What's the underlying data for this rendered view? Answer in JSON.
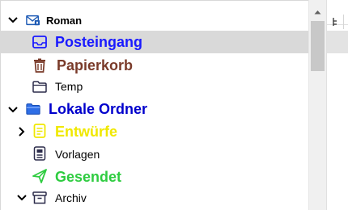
{
  "colors": {
    "selection": "#d9d9d9",
    "inbox_blue": "#1a1aff",
    "trash_brown": "#7a3b2a",
    "local_folders_blue": "#0000cc",
    "drafts_yellow": "#f0e800",
    "sent_green": "#2ecc40"
  },
  "tree": {
    "account": {
      "label": "Roman",
      "icon": "mail-account-icon"
    },
    "inbox": {
      "label": "Posteingang",
      "icon": "inbox-icon"
    },
    "trash": {
      "label": "Papierkorb",
      "icon": "trash-icon"
    },
    "temp": {
      "label": "Temp",
      "icon": "folder-icon"
    },
    "local_folders": {
      "label": "Lokale Ordner",
      "icon": "folder-icon"
    },
    "drafts": {
      "label": "Entwürfe",
      "icon": "drafts-icon"
    },
    "templates": {
      "label": "Vorlagen",
      "icon": "templates-icon"
    },
    "sent": {
      "label": "Gesendet",
      "icon": "send-icon"
    },
    "archive": {
      "label": "Archiv",
      "icon": "archive-icon"
    }
  }
}
